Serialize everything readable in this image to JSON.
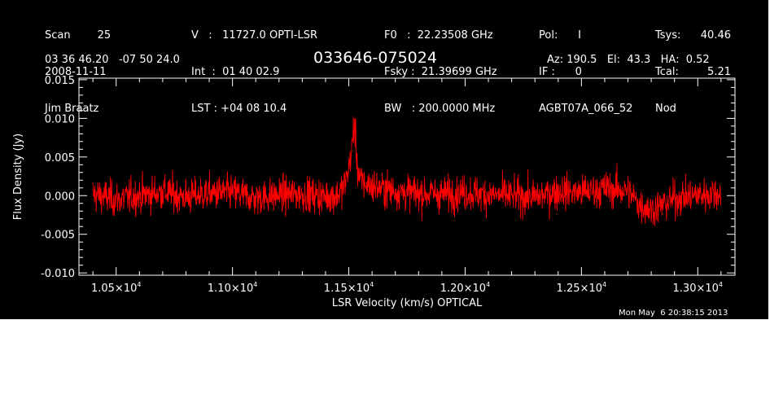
{
  "header": {
    "col1": {
      "line1": "Scan        25",
      "line2": "2008-11-11",
      "line3": "Jim Braatz"
    },
    "col2": {
      "line1": "V   :   11727.0 OPTI-LSR",
      "line2": "Int  :  01 40 02.9",
      "line3": "LST : +04 08 10.4"
    },
    "col3": {
      "line1": "F0   :  22.23508 GHz",
      "line2": "Fsky :  21.39699 GHz",
      "line3": "BW   : 200.0000 MHz"
    },
    "col4": {
      "line1": "Pol:      I",
      "line2": "IF :      0",
      "line3": "AGBT07A_066_52"
    },
    "col5": {
      "line1": "Tsys:",
      "line2": "Tcal:",
      "line3": "Nod"
    },
    "col6": {
      "line1": "40.46",
      "line2": "5.21"
    },
    "coords": "03 36 46.20   -07 50 24.0",
    "source": "033646-075024",
    "az_el_ha": "Az: 190.5   El:  43.3   HA:  0.52"
  },
  "timestamp": "Mon May  6 20:38:15 2013",
  "colors": {
    "background": "#000000",
    "axes": "#ffffff",
    "series": "#ff0000"
  },
  "chart_data": {
    "type": "line",
    "xlabel": "LSR Velocity (km/s) OPTICAL",
    "ylabel": "Flux Density (Jy)",
    "xlim": [
      10340,
      13160
    ],
    "ylim": [
      -0.0103,
      0.0152
    ],
    "x_ticks": [
      {
        "value": 10500,
        "mant": "1.05",
        "exp": "4"
      },
      {
        "value": 11000,
        "mant": "1.10",
        "exp": "4"
      },
      {
        "value": 11500,
        "mant": "1.15",
        "exp": "4"
      },
      {
        "value": 12000,
        "mant": "1.20",
        "exp": "4"
      },
      {
        "value": 12500,
        "mant": "1.25",
        "exp": "4"
      },
      {
        "value": 13000,
        "mant": "1.30",
        "exp": "4"
      }
    ],
    "y_ticks": [
      {
        "value": 0.015,
        "label": "0.015"
      },
      {
        "value": 0.01,
        "label": "0.010"
      },
      {
        "value": 0.005,
        "label": "0.005"
      },
      {
        "value": 0.0,
        "label": "0.000"
      },
      {
        "value": -0.005,
        "label": "-0.005"
      },
      {
        "value": -0.01,
        "label": "-0.010"
      }
    ],
    "series": [
      {
        "x": [
          10400,
          10500,
          10600,
          10700,
          10800,
          10900,
          11000,
          11100,
          11200,
          11300,
          11400,
          11450,
          11480,
          11500,
          11510,
          11520,
          11530,
          11540,
          11550,
          11600,
          11700,
          11800,
          11900,
          12000,
          12100,
          12200,
          12300,
          12400,
          12500,
          12600,
          12700,
          12750,
          12800,
          12850,
          12900,
          13000,
          13100
        ],
        "y": [
          0.0002,
          -0.0005,
          0.0,
          0.0005,
          -0.0002,
          0.0003,
          0.0004,
          -0.0003,
          0.0001,
          0.0002,
          -0.0001,
          0.0,
          0.0012,
          0.0035,
          0.0055,
          0.0068,
          0.0052,
          0.0032,
          0.0018,
          0.0012,
          0.0006,
          0.0003,
          0.0002,
          0.0004,
          0.0001,
          0.0,
          -0.0002,
          0.0006,
          0.0004,
          0.0009,
          0.0006,
          -0.0012,
          -0.0018,
          -0.0012,
          -0.0004,
          0.0001,
          0.0004
        ]
      }
    ]
  }
}
